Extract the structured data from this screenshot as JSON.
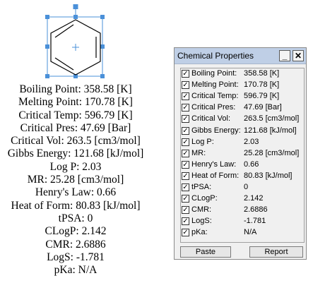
{
  "calculated_text": [
    "Boiling Point: 358.58 [K]",
    "Melting Point: 170.78 [K]",
    "Critical Temp: 596.79 [K]",
    "Critical Pres: 47.69 [Bar]",
    "Critical Vol: 263.5 [cm3/mol]",
    "Gibbs Energy: 121.68 [kJ/mol]",
    "Log P: 2.03",
    "MR: 25.28 [cm3/mol]",
    "Henry's Law: 0.66",
    "Heat of Form: 80.83 [kJ/mol]",
    "tPSA: 0",
    "CLogP: 2.142",
    "CMR: 2.6886",
    "LogS: -1.781",
    "pKa: N/A"
  ],
  "window": {
    "title": "Chemical Properties",
    "min_label": "_",
    "close_label": "✕",
    "paste_label": "Paste",
    "report_label": "Report",
    "check_glyph": "✓",
    "properties": [
      {
        "label": "Boiling Point:",
        "value": "358.58 [K]",
        "checked": true
      },
      {
        "label": "Melting Point:",
        "value": "170.78 [K]",
        "checked": true
      },
      {
        "label": "Critical Temp:",
        "value": "596.79 [K]",
        "checked": true
      },
      {
        "label": "Critical Pres:",
        "value": "47.69 [Bar]",
        "checked": true
      },
      {
        "label": "Critical Vol:",
        "value": "263.5 [cm3/mol]",
        "checked": true
      },
      {
        "label": "Gibbs Energy:",
        "value": "121.68 [kJ/mol]",
        "checked": true
      },
      {
        "label": "Log P:",
        "value": "2.03",
        "checked": true
      },
      {
        "label": "MR:",
        "value": "25.28 [cm3/mol]",
        "checked": true
      },
      {
        "label": "Henry's Law:",
        "value": "0.66",
        "checked": true
      },
      {
        "label": "Heat of Form:",
        "value": "80.83 [kJ/mol]",
        "checked": true
      },
      {
        "label": "tPSA:",
        "value": "0",
        "checked": true
      },
      {
        "label": "CLogP:",
        "value": "2.142",
        "checked": true
      },
      {
        "label": "CMR:",
        "value": "2.6886",
        "checked": true
      },
      {
        "label": "LogS:",
        "value": "-1.781",
        "checked": true
      },
      {
        "label": "pKa:",
        "value": "N/A",
        "checked": true
      }
    ]
  },
  "colors": {
    "selection": "#4a90d9",
    "titlebar": "#bfcfe6"
  }
}
